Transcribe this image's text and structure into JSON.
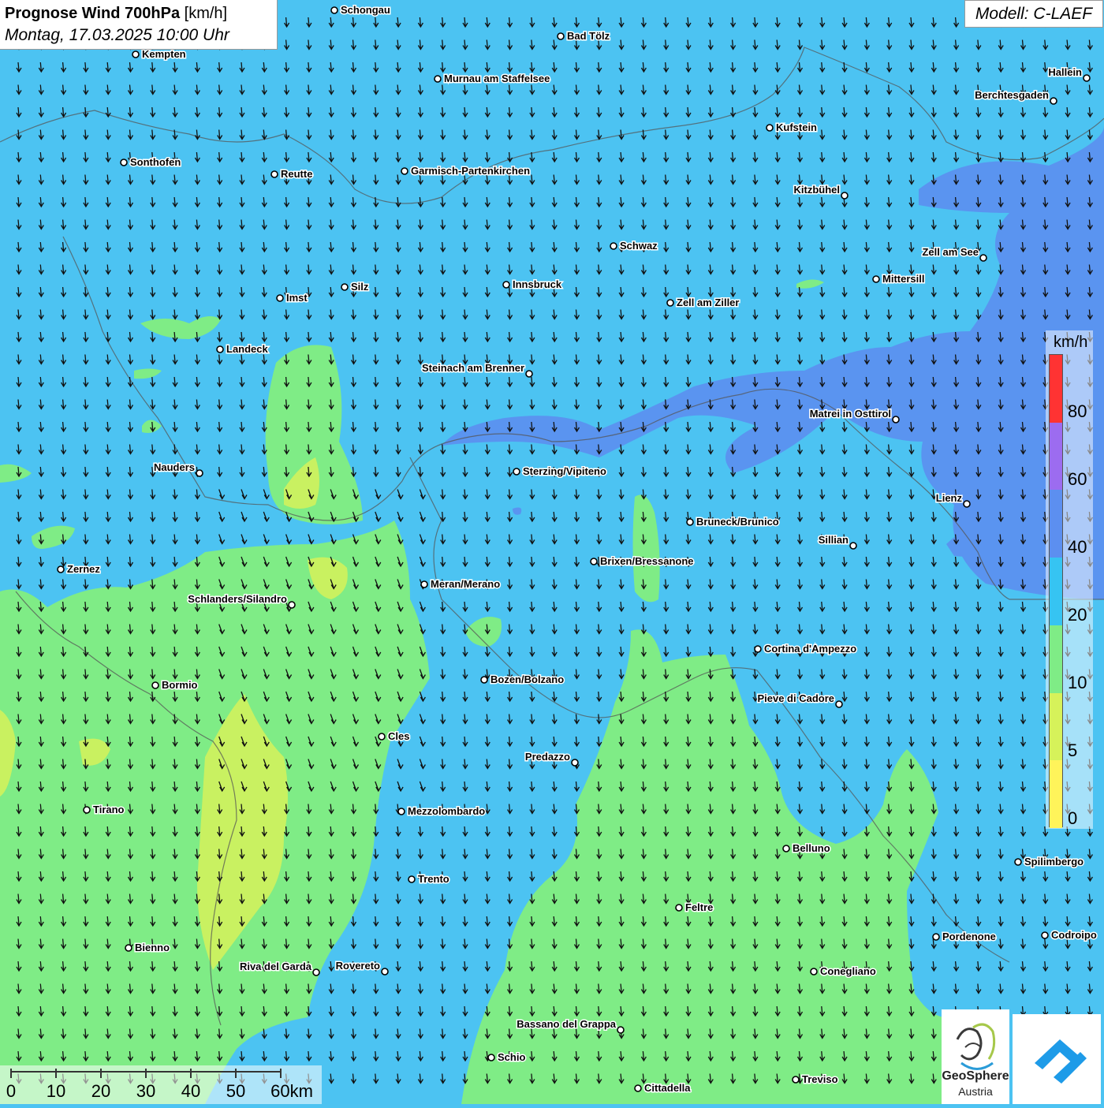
{
  "title": {
    "main": "Prognose Wind 700hPa",
    "unit": "[km/h]",
    "datetime": "Montag, 17.03.2025 10:00 Uhr"
  },
  "model_label": "Modell: C-LAEF",
  "legend": {
    "unit": "km/h",
    "labels": [
      "80",
      "60",
      "40",
      "20",
      "10",
      "5",
      "0"
    ],
    "colors": [
      "#ff3333",
      "#9c6cf0",
      "#5c8ff0",
      "#36c4f2",
      "#7fec86",
      "#d6f25a",
      "#fff45a"
    ]
  },
  "scale": {
    "labels": [
      "0",
      "10",
      "20",
      "30",
      "40",
      "50",
      "60km"
    ]
  },
  "logos": {
    "geosphere_line1": "GeoSphere",
    "geosphere_line2": "Austria"
  },
  "cities": [
    {
      "name": "Schongau"
    },
    {
      "name": "Bad Tölz"
    },
    {
      "name": "Kempten"
    },
    {
      "name": "Murnau am Staffelsee"
    },
    {
      "name": "Hallein"
    },
    {
      "name": "Berchtesgaden"
    },
    {
      "name": "Kufstein"
    },
    {
      "name": "Sonthofen"
    },
    {
      "name": "Reutte"
    },
    {
      "name": "Garmisch-Partenkirchen"
    },
    {
      "name": "Kitzbühel"
    },
    {
      "name": "Schwaz"
    },
    {
      "name": "Zell am See"
    },
    {
      "name": "Mittersill"
    },
    {
      "name": "Innsbruck"
    },
    {
      "name": "Silz"
    },
    {
      "name": "Imst"
    },
    {
      "name": "Zell am Ziller"
    },
    {
      "name": "Landeck"
    },
    {
      "name": "Steinach am Brenner"
    },
    {
      "name": "Matrei in Osttirol"
    },
    {
      "name": "Nauders"
    },
    {
      "name": "Sterzing/Vipiteno"
    },
    {
      "name": "Lienz"
    },
    {
      "name": "Bruneck/Brunico"
    },
    {
      "name": "Sillian"
    },
    {
      "name": "Zernez"
    },
    {
      "name": "Brixen/Bressanone"
    },
    {
      "name": "Meran/Merano"
    },
    {
      "name": "Schlanders/Silandro"
    },
    {
      "name": "Cortina d'Ampezzo"
    },
    {
      "name": "Bozen/Bolzano"
    },
    {
      "name": "Bormio"
    },
    {
      "name": "Pieve di Cadore"
    },
    {
      "name": "Cles"
    },
    {
      "name": "Predazzo"
    },
    {
      "name": "Tirano"
    },
    {
      "name": "Mezzolombardo"
    },
    {
      "name": "Belluno"
    },
    {
      "name": "Spilimbergo"
    },
    {
      "name": "Trento"
    },
    {
      "name": "Feltre"
    },
    {
      "name": "Bienno"
    },
    {
      "name": "Pordenone"
    },
    {
      "name": "Codroipo"
    },
    {
      "name": "Riva del Garda"
    },
    {
      "name": "Rovereto"
    },
    {
      "name": "Conegliano"
    },
    {
      "name": "Bassano del Grappa"
    },
    {
      "name": "Schio"
    },
    {
      "name": "Cittadella"
    },
    {
      "name": "Treviso"
    }
  ]
}
